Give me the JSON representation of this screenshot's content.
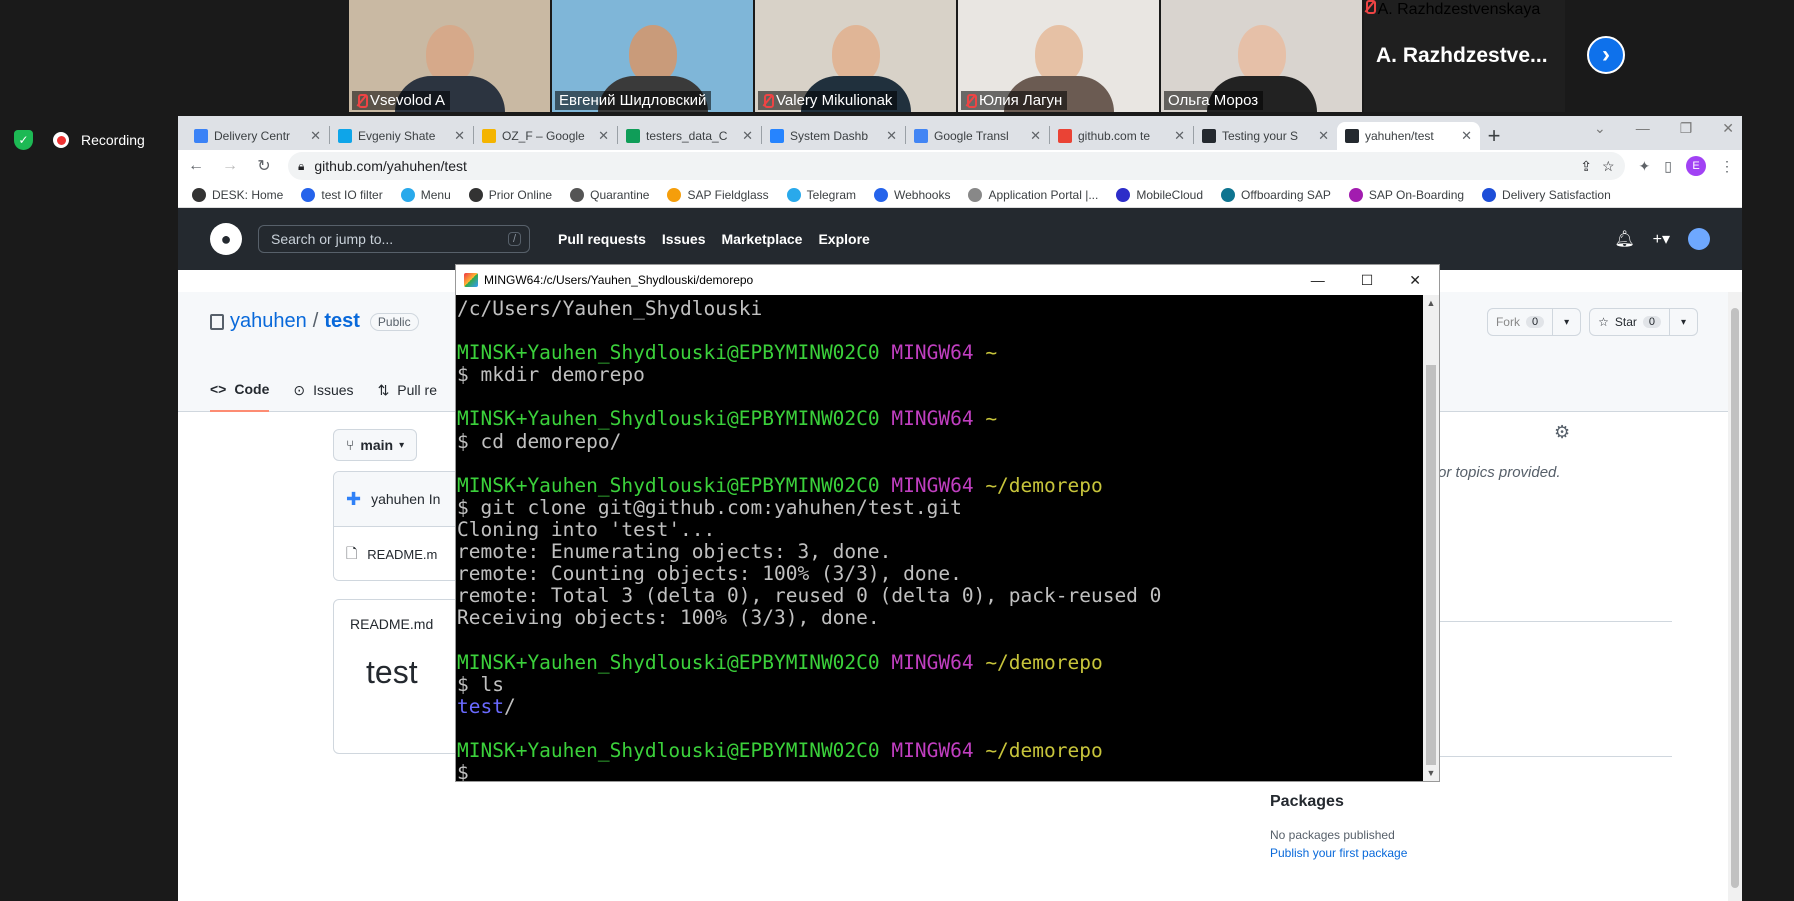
{
  "zoom": {
    "participants": [
      {
        "name": "Vsevolod A",
        "muted": true,
        "bg": "#c9b9a3",
        "skin": "#d6a98a",
        "shirt": "#2c3440"
      },
      {
        "name": "Евгений Шидловский",
        "muted": false,
        "bg": "#7fb6d8",
        "skin": "#c99b7a",
        "shirt": "#3a3a3a"
      },
      {
        "name": "Valery Mikulionak",
        "muted": true,
        "bg": "#d8d2c8",
        "skin": "#e0b596",
        "shirt": "#20303d"
      },
      {
        "name": "Юлия Лагун",
        "muted": true,
        "bg": "#e9e6e2",
        "skin": "#e6c1a5",
        "shirt": "#6b5b52"
      },
      {
        "name": "Ольга Мороз",
        "muted": false,
        "bg": "#d9d4cf",
        "skin": "#e6c0a8",
        "shirt": "#222"
      }
    ],
    "name_tile": {
      "big": "A.  Razhdzestve...",
      "name": "A. Razhdzestvenskaya",
      "muted": true
    },
    "next_icon": "chevron-right-icon",
    "recording_label": "Recording"
  },
  "browser": {
    "tabs": [
      {
        "title": "Delivery Centr",
        "color": "#3b82f6"
      },
      {
        "title": "Evgeniy Shate",
        "color": "#0ea5e9"
      },
      {
        "title": "OZ_F – Google",
        "color": "#f4b400"
      },
      {
        "title": "testers_data_C",
        "color": "#0f9d58"
      },
      {
        "title": "System Dashb",
        "color": "#2684ff"
      },
      {
        "title": "Google Transl",
        "color": "#4285f4"
      },
      {
        "title": "github.com te",
        "color": "#ea4335"
      },
      {
        "title": "Testing your S",
        "color": "#24292f"
      },
      {
        "title": "yahuhen/test",
        "color": "#24292f"
      }
    ],
    "active_tab": 8,
    "url": "github.com/yahuhen/test",
    "profile_initial": "E",
    "bookmarks": [
      {
        "label": "DESK: Home",
        "color": "#333"
      },
      {
        "label": "test IO filter",
        "color": "#2563eb"
      },
      {
        "label": "Menu",
        "color": "#29a9eb"
      },
      {
        "label": "Prior Online",
        "color": "#333"
      },
      {
        "label": "Quarantine",
        "color": "#555"
      },
      {
        "label": "SAP Fieldglass",
        "color": "#f59e0b"
      },
      {
        "label": "Telegram",
        "color": "#29a9eb"
      },
      {
        "label": "Webhooks",
        "color": "#2563eb"
      },
      {
        "label": "Application Portal |...",
        "color": "#888"
      },
      {
        "label": "MobileCloud",
        "color": "#2d2dc9"
      },
      {
        "label": "Offboarding SAP",
        "color": "#0e7490"
      },
      {
        "label": "SAP On-Boarding",
        "color": "#a21caf"
      },
      {
        "label": "Delivery Satisfaction",
        "color": "#1d4ed8"
      }
    ]
  },
  "github": {
    "search_placeholder": "Search or jump to...",
    "search_key": "/",
    "nav": [
      "Pull requests",
      "Issues",
      "Marketplace",
      "Explore"
    ],
    "owner": "yahuhen",
    "repo": "test",
    "visibility": "Public",
    "fork_count": "0",
    "star_label": "Star",
    "star_count": "0",
    "tabs": [
      "Code",
      "Issues",
      "Pull re"
    ],
    "branch": "main",
    "commit_author": "yahuhen In",
    "file": "README.m",
    "readme_header": "README.md",
    "readme_title": "test",
    "about_text": "or topics provided.",
    "packages_title": "Packages",
    "packages_text": "No packages published",
    "packages_link": "Publish your first package"
  },
  "terminal": {
    "title": "MINGW64:/c/Users/Yauhen_Shydlouski/demorepo",
    "lines": [
      [
        {
          "t": "/c/Users/Yauhen_Shydlouski",
          "c": ""
        }
      ],
      [
        {
          "t": "",
          "c": ""
        }
      ],
      [
        {
          "t": "MINSK+Yauhen_Shydlouski@EPBYMINW02C0 ",
          "c": "t-green"
        },
        {
          "t": "MINGW64",
          "c": "t-mag"
        },
        {
          "t": " ~",
          "c": "t-yel"
        }
      ],
      [
        {
          "t": "$ mkdir demorepo",
          "c": ""
        }
      ],
      [
        {
          "t": "",
          "c": ""
        }
      ],
      [
        {
          "t": "MINSK+Yauhen_Shydlouski@EPBYMINW02C0 ",
          "c": "t-green"
        },
        {
          "t": "MINGW64",
          "c": "t-mag"
        },
        {
          "t": " ~",
          "c": "t-yel"
        }
      ],
      [
        {
          "t": "$ cd demorepo/",
          "c": ""
        }
      ],
      [
        {
          "t": "",
          "c": ""
        }
      ],
      [
        {
          "t": "MINSK+Yauhen_Shydlouski@EPBYMINW02C0 ",
          "c": "t-green"
        },
        {
          "t": "MINGW64",
          "c": "t-mag"
        },
        {
          "t": " ~/demorepo",
          "c": "t-yel"
        }
      ],
      [
        {
          "t": "$ git clone git@github.com:yahuhen/test.git",
          "c": ""
        }
      ],
      [
        {
          "t": "Cloning into 'test'...",
          "c": ""
        }
      ],
      [
        {
          "t": "remote: Enumerating objects: 3, done.",
          "c": ""
        }
      ],
      [
        {
          "t": "remote: Counting objects: 100% (3/3), done.",
          "c": ""
        }
      ],
      [
        {
          "t": "remote: Total 3 (delta 0), reused 0 (delta 0), pack-reused 0",
          "c": ""
        }
      ],
      [
        {
          "t": "Receiving objects: 100% (3/3), done.",
          "c": ""
        }
      ],
      [
        {
          "t": "",
          "c": ""
        }
      ],
      [
        {
          "t": "MINSK+Yauhen_Shydlouski@EPBYMINW02C0 ",
          "c": "t-green"
        },
        {
          "t": "MINGW64",
          "c": "t-mag"
        },
        {
          "t": " ~/demorepo",
          "c": "t-yel"
        }
      ],
      [
        {
          "t": "$ ls",
          "c": ""
        }
      ],
      [
        {
          "t": "test",
          "c": "t-blue"
        },
        {
          "t": "/",
          "c": ""
        }
      ],
      [
        {
          "t": "",
          "c": ""
        }
      ],
      [
        {
          "t": "MINSK+Yauhen_Shydlouski@EPBYMINW02C0 ",
          "c": "t-green"
        },
        {
          "t": "MINGW64",
          "c": "t-mag"
        },
        {
          "t": " ~/demorepo",
          "c": "t-yel"
        }
      ],
      [
        {
          "t": "$ ",
          "c": ""
        }
      ]
    ]
  }
}
